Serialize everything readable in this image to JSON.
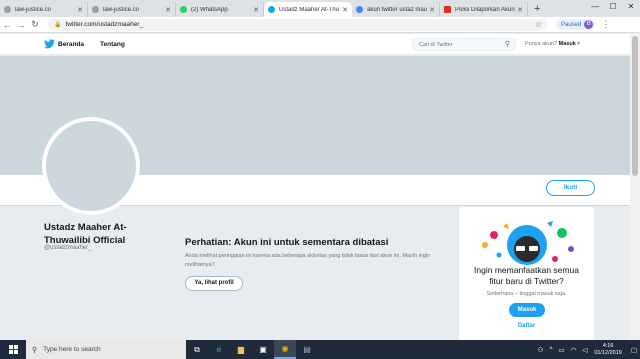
{
  "browser": {
    "tabs": [
      {
        "label": "law-justice.co",
        "color": "#9aa0a6",
        "active": false
      },
      {
        "label": "law-justice.co",
        "color": "#9aa0a6",
        "active": false
      },
      {
        "label": "(2) WhatsApp",
        "color": "#25d366",
        "active": false
      },
      {
        "label": "Ustadz Maaher At-Thu",
        "color": "#1da1f2",
        "active": true
      },
      {
        "label": "akun twitter ustaz mau",
        "color": "#4285f4",
        "active": false
      },
      {
        "label": "Polisi Dilaporkan Akun",
        "color": "#d93025",
        "active": false
      }
    ],
    "new_tab": "+",
    "url": "twitter.com/ustadzmaaher_",
    "paused_label": "Paused",
    "profile_initial": "B"
  },
  "twitter": {
    "nav_home": "Beranda",
    "nav_about": "Tentang",
    "search_placeholder": "Cari di Twitter",
    "account_prompt": "Punya akun?",
    "login": "Masuk",
    "follow": "Ikuti",
    "profile_name": "Ustadz Maaher At-Thuwailibi Official",
    "profile_handle": "@ustadzmaaher_",
    "warning_title": "Perhatian: Akun ini untuk sementara dibatasi",
    "warning_text": "Anda melihat peringatan ini karena ada beberapa aktivitas yang tidak biasa dari akun ini. Masih ingin melihatnya?",
    "view_profile": "Ya, lihat profil",
    "card_title": "Ingin memanfaatkan semua fitur baru di Twitter?",
    "card_subtitle": "Sederhana – tinggal masuk saja.",
    "card_button": "Masuk",
    "card_link": "Daftar"
  },
  "taskbar": {
    "search_placeholder": "Type here to search",
    "time": "4:16",
    "date": "01/12/2019"
  }
}
